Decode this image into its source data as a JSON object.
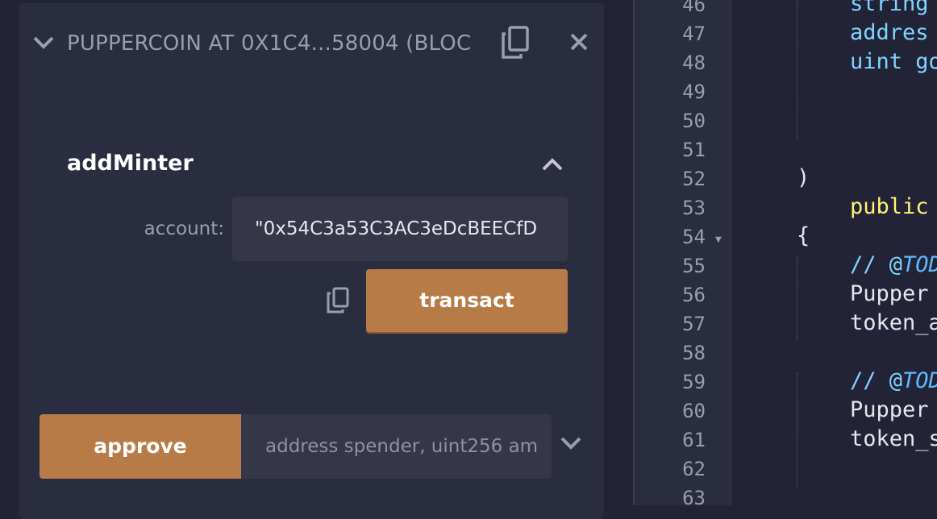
{
  "contract": {
    "title": "PUPPERCOIN AT 0X1C4...58004 (BLOC",
    "icons": {
      "expand": "chevron-down-icon",
      "copy": "copy-icon",
      "close": "close-icon"
    }
  },
  "function": {
    "name": "addMinter",
    "param_label": "account:",
    "param_value": "\"0x54C3a53C3AC3eDcBEECfD",
    "transact_label": "transact"
  },
  "approve": {
    "button_label": "approve",
    "placeholder": "address spender, uint256 am"
  },
  "editor": {
    "line_numbers": [
      "46",
      "47",
      "48",
      "49",
      "50",
      "51",
      "52",
      "53",
      "54",
      "55",
      "56",
      "57",
      "58",
      "59",
      "60",
      "61",
      "62",
      "63"
    ],
    "lines": [
      {
        "text": "string ",
        "color": "#7fd4ff"
      },
      {
        "text": "addres",
        "color": "#7fd4ff"
      },
      {
        "text": "uint go",
        "color": "#7fd4ff"
      },
      {
        "text": "",
        "color": "#e6e6ee"
      },
      {
        "text": "",
        "color": "#e6e6ee"
      },
      {
        "text": "",
        "color": "#e6e6ee"
      },
      {
        "text": ")",
        "color": "#e6e6ee"
      },
      {
        "text": "public",
        "color": "#fff176"
      },
      {
        "text": "{",
        "color": "#e6e6ee"
      },
      {
        "text": "// @TOD",
        "color": "#7fd4ff"
      },
      {
        "text": "Pupper",
        "color": "#e6e6ee"
      },
      {
        "text": "token_a",
        "color": "#e6e6ee"
      },
      {
        "text": "",
        "color": "#e6e6ee"
      },
      {
        "text": "// @TOD",
        "color": "#7fd4ff"
      },
      {
        "text": "Pupper",
        "color": "#e6e6ee"
      },
      {
        "text": "token_s",
        "color": "#e6e6ee"
      },
      {
        "text": "",
        "color": "#e6e6ee"
      },
      {
        "text": "",
        "color": "#e6e6ee"
      }
    ]
  },
  "colors": {
    "accent": "#b77b47",
    "panel": "#2a2c3f",
    "background": "#222336",
    "input": "#353749"
  }
}
